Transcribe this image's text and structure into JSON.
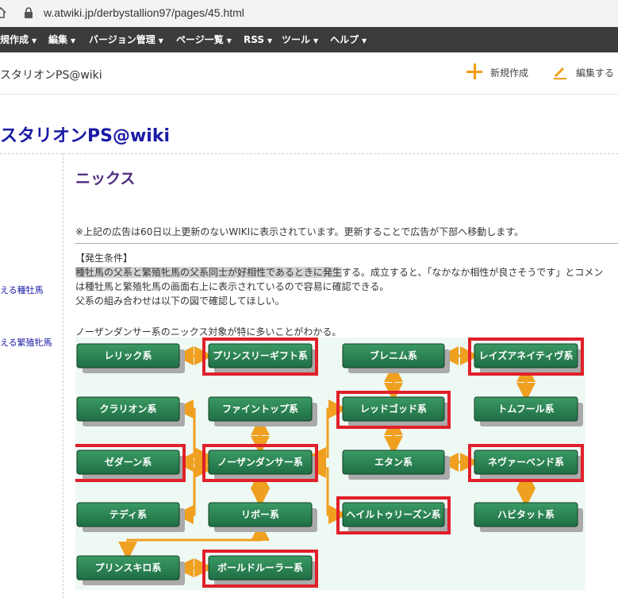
{
  "browser": {
    "url": "w.atwiki.jp/derbystallion97/pages/45.html"
  },
  "menubar": {
    "items": [
      {
        "label": "規作成",
        "caret": "▼"
      },
      {
        "label": "編集",
        "caret": "▼"
      },
      {
        "label": "バージョン管理",
        "caret": "▼"
      },
      {
        "label": "ページ一覧",
        "caret": "▼"
      },
      {
        "label": "RSS",
        "caret": "▼"
      },
      {
        "label": "ツール",
        "caret": "▼"
      },
      {
        "label": "ヘルプ",
        "caret": "▼"
      }
    ]
  },
  "sitebar": {
    "name": "スタリオンPS@wiki",
    "new_label": "新規作成",
    "edit_label": "編集する"
  },
  "site_title": "スタリオンPS@wiki",
  "sidebar": {
    "links": [
      "える種牡馬",
      "える繁殖牝馬"
    ]
  },
  "page": {
    "title": "ニックス",
    "notice": "※上記の広告は60日以上更新のないWIKIに表示されています。更新することで広告が下部へ移動します。",
    "section_heading": "【発生条件】",
    "line1_highlight": "種牡馬の父系と繁殖牝馬の父系同士が好相性であるときに発生",
    "line1_rest": "する。成立すると、「なかなか相性が良さそうです」とコメン",
    "line2": "は種牡馬と繁殖牝馬の画面右上に表示されているので容易に確認できる。",
    "line3": "父系の組み合わせは以下の図で確認してほしい。",
    "line4": "ノーザンダンサー系のニックス対象が特に多いことがわかる。"
  },
  "diagram": {
    "colors": {
      "node": "#1f6e44",
      "node_light": "#3a9a64",
      "arrow": "#f0a020",
      "highlight": "#e0202a",
      "shadow": "#aaaaaa"
    },
    "nodes": [
      {
        "id": "relic",
        "label": "レリック系",
        "highlight": false
      },
      {
        "id": "princely",
        "label": "プリンスリーギフト系",
        "highlight": true
      },
      {
        "id": "blenheim",
        "label": "ブレニム系",
        "highlight": false
      },
      {
        "id": "raise",
        "label": "レイズアネイティヴ系",
        "highlight": true
      },
      {
        "id": "clarion",
        "label": "クラリオン系",
        "highlight": false
      },
      {
        "id": "finetop",
        "label": "ファイントップ系",
        "highlight": false
      },
      {
        "id": "redgod",
        "label": "レッドゴッド系",
        "highlight": true
      },
      {
        "id": "tomfool",
        "label": "トムフール系",
        "highlight": false
      },
      {
        "id": "zeddaan",
        "label": "ゼダーン系",
        "highlight": true
      },
      {
        "id": "northern",
        "label": "ノーザンダンサー系",
        "highlight": true
      },
      {
        "id": "etan",
        "label": "エタン系",
        "highlight": false
      },
      {
        "id": "never",
        "label": "ネヴァーベンド系",
        "highlight": true
      },
      {
        "id": "teddy",
        "label": "テディ系",
        "highlight": false
      },
      {
        "id": "ribot",
        "label": "リボー系",
        "highlight": false
      },
      {
        "id": "hail",
        "label": "ヘイルトゥリーズン系",
        "highlight": true
      },
      {
        "id": "habitat",
        "label": "ハビタット系",
        "highlight": false
      },
      {
        "id": "princequillo",
        "label": "プリンスキロ系",
        "highlight": false
      },
      {
        "id": "bold",
        "label": "ボールドルーラー系",
        "highlight": true
      }
    ],
    "links": [
      [
        "relic",
        "princely"
      ],
      [
        "blenheim",
        "raise"
      ],
      [
        "blenheim",
        "redgod"
      ],
      [
        "raise",
        "tomfool"
      ],
      [
        "finetop",
        "northern"
      ],
      [
        "northern",
        "clarion"
      ],
      [
        "northern",
        "zeddaan"
      ],
      [
        "northern",
        "teddy"
      ],
      [
        "northern",
        "ribot"
      ],
      [
        "northern",
        "redgod"
      ],
      [
        "northern",
        "hail"
      ],
      [
        "redgod",
        "etan"
      ],
      [
        "never",
        "etan"
      ],
      [
        "never",
        "habitat"
      ],
      [
        "ribot",
        "princequillo"
      ],
      [
        "princequillo",
        "bold"
      ]
    ]
  }
}
